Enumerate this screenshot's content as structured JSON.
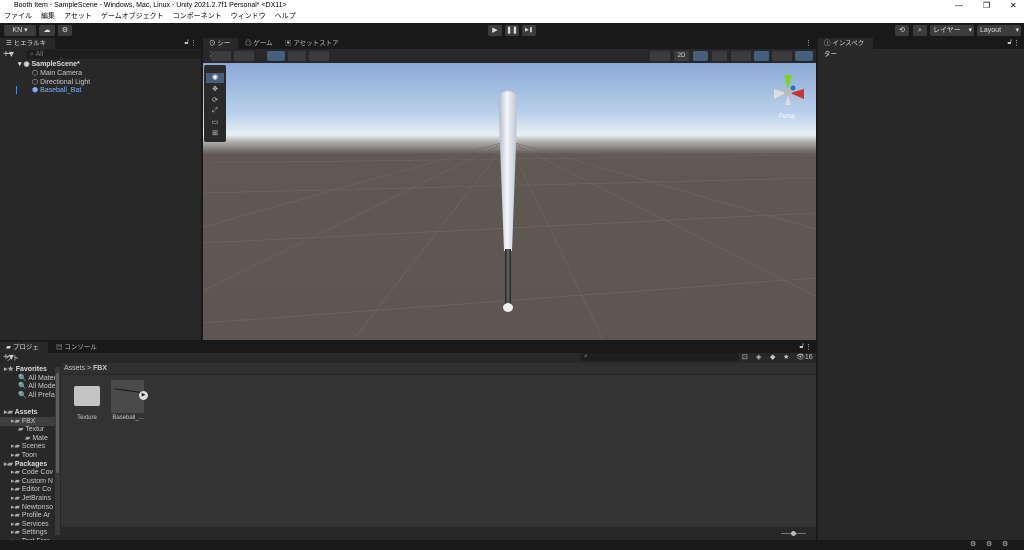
{
  "window": {
    "title": "Booth Item - SampleScene - Windows, Mac, Linux - Unity 2021.2.7f1 Personal* <DX11>",
    "minimize": "—",
    "maximize": "❐",
    "close": "✕"
  },
  "menu": [
    "ファイル",
    "編集",
    "アセット",
    "ゲームオブジェクト",
    "コンポーネント",
    "ウィンドウ",
    "ヘルプ"
  ],
  "toolbar": {
    "account": "KN ▾",
    "layers": "レイヤー",
    "layout": "Layout",
    "play": "▶",
    "pause": "❚❚",
    "step": "▶❚"
  },
  "hierarchy": {
    "tab": "ヒエラルキー",
    "search_placeholder": "All",
    "scene": "SampleScene*",
    "items": [
      "Main Camera",
      "Directional Light",
      "Baseball_Bat"
    ]
  },
  "scene": {
    "tabs": [
      "シーン",
      "ゲーム",
      "アセットストア"
    ],
    "btn_2d": "2D",
    "persp": "Persp"
  },
  "inspector": {
    "tab": "インスペクター"
  },
  "project": {
    "tabs": [
      "プロジェクト",
      "コンソール"
    ],
    "breadcrumb": [
      "Assets",
      "FBX"
    ],
    "count": "16",
    "tree": [
      {
        "label": "Favorites",
        "indent": 0,
        "bold": true,
        "icon": "★"
      },
      {
        "label": "All Mater",
        "indent": 2,
        "icon": "🔍"
      },
      {
        "label": "All Model",
        "indent": 2,
        "icon": "🔍"
      },
      {
        "label": "All Prefat",
        "indent": 2,
        "icon": "🔍"
      },
      {
        "label": "",
        "indent": 0
      },
      {
        "label": "Assets",
        "indent": 0,
        "bold": true,
        "icon": "▰"
      },
      {
        "label": "FBX",
        "indent": 1,
        "icon": "▰",
        "selected": true
      },
      {
        "label": "Textur",
        "indent": 2,
        "icon": "▰"
      },
      {
        "label": "Mate",
        "indent": 3,
        "icon": "▰"
      },
      {
        "label": "Scenes",
        "indent": 1,
        "icon": "▰"
      },
      {
        "label": "Toon",
        "indent": 1,
        "icon": "▰"
      },
      {
        "label": "Packages",
        "indent": 0,
        "bold": true,
        "icon": "▰"
      },
      {
        "label": "Code Cov",
        "indent": 1,
        "icon": "▰"
      },
      {
        "label": "Custom N",
        "indent": 1,
        "icon": "▰"
      },
      {
        "label": "Editor Co",
        "indent": 1,
        "icon": "▰"
      },
      {
        "label": "JetBrains",
        "indent": 1,
        "icon": "▰"
      },
      {
        "label": "Newtonso",
        "indent": 1,
        "icon": "▰"
      },
      {
        "label": "Profile Ar",
        "indent": 1,
        "icon": "▰"
      },
      {
        "label": "Services",
        "indent": 1,
        "icon": "▰"
      },
      {
        "label": "Settings",
        "indent": 1,
        "icon": "▰"
      },
      {
        "label": "Test Frar",
        "indent": 1,
        "icon": "▰"
      }
    ],
    "assets": [
      "Texture",
      "Baseball_..."
    ]
  }
}
